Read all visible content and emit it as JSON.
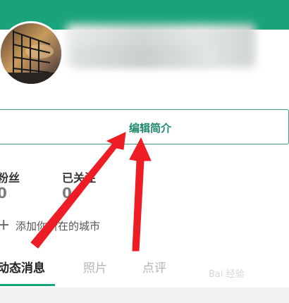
{
  "header": {
    "accent_color": "#1aa37a"
  },
  "profile": {
    "avatar_icon": "avatar-photo-icon"
  },
  "edit_bio": {
    "label": "编辑简介"
  },
  "stats": {
    "fans": {
      "label": "粉丝",
      "value": "0"
    },
    "following": {
      "label": "已关注",
      "value": "0"
    }
  },
  "city": {
    "icon": "plus-icon",
    "label": "添加你所在的城市"
  },
  "tabs": [
    {
      "label": "动态消息",
      "active": true
    },
    {
      "label": "照片",
      "active": false
    },
    {
      "label": "点评",
      "active": false
    }
  ],
  "annotation": {
    "arrow_color": "#ee1c25"
  }
}
